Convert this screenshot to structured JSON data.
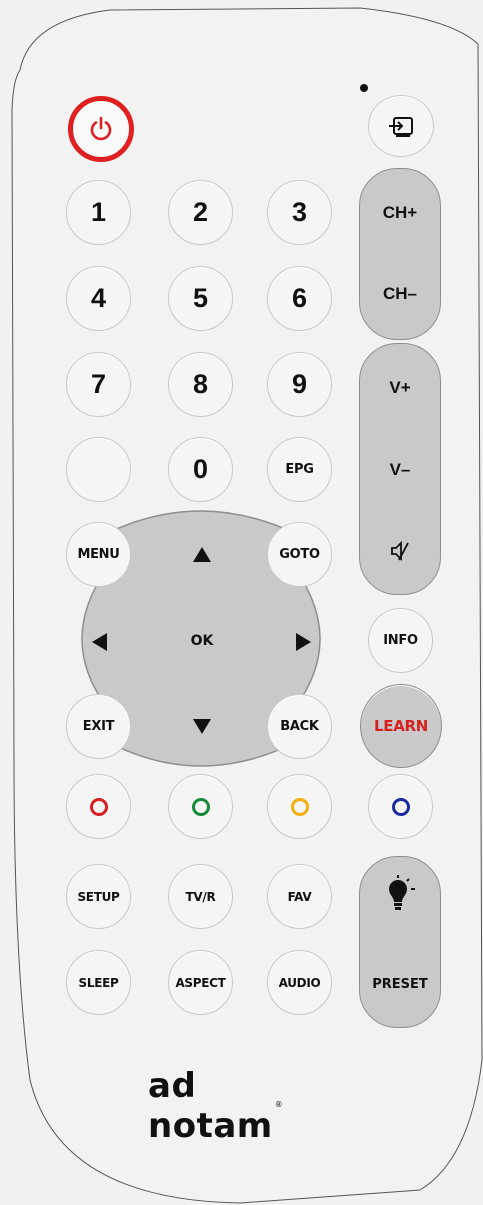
{
  "brand": {
    "logo_text": "ad notam",
    "trademark": "®"
  },
  "colors": {
    "body": "#f1f1f1",
    "button": "#f5f5f5",
    "rocker": "#c9c9c9",
    "power": "#e02020",
    "learn_text": "#d62020",
    "red": "#d62020",
    "green": "#138a3a",
    "yellow": "#f0b010",
    "blue": "#1a2aa0"
  },
  "buttons": {
    "digits": [
      "1",
      "2",
      "3",
      "4",
      "5",
      "6",
      "7",
      "8",
      "9",
      "0"
    ],
    "epg": "EPG",
    "menu": "MENU",
    "goto": "GOTO",
    "ok": "OK",
    "exit": "EXIT",
    "back": "BACK",
    "info": "INFO",
    "learn": "LEARN",
    "setup": "SETUP",
    "tvr": "TV/R",
    "fav": "FAV",
    "sleep": "SLEEP",
    "aspect": "ASPECT",
    "audio": "AUDIO",
    "preset": "PRESET"
  },
  "channel": {
    "up": "CH+",
    "down": "CH–"
  },
  "volume": {
    "up": "V+",
    "down": "V–"
  },
  "icons": [
    "power-icon",
    "input-source-icon",
    "mute-icon",
    "lightbulb-icon",
    "up-arrow-icon",
    "down-arrow-icon",
    "left-arrow-icon",
    "right-arrow-icon"
  ]
}
